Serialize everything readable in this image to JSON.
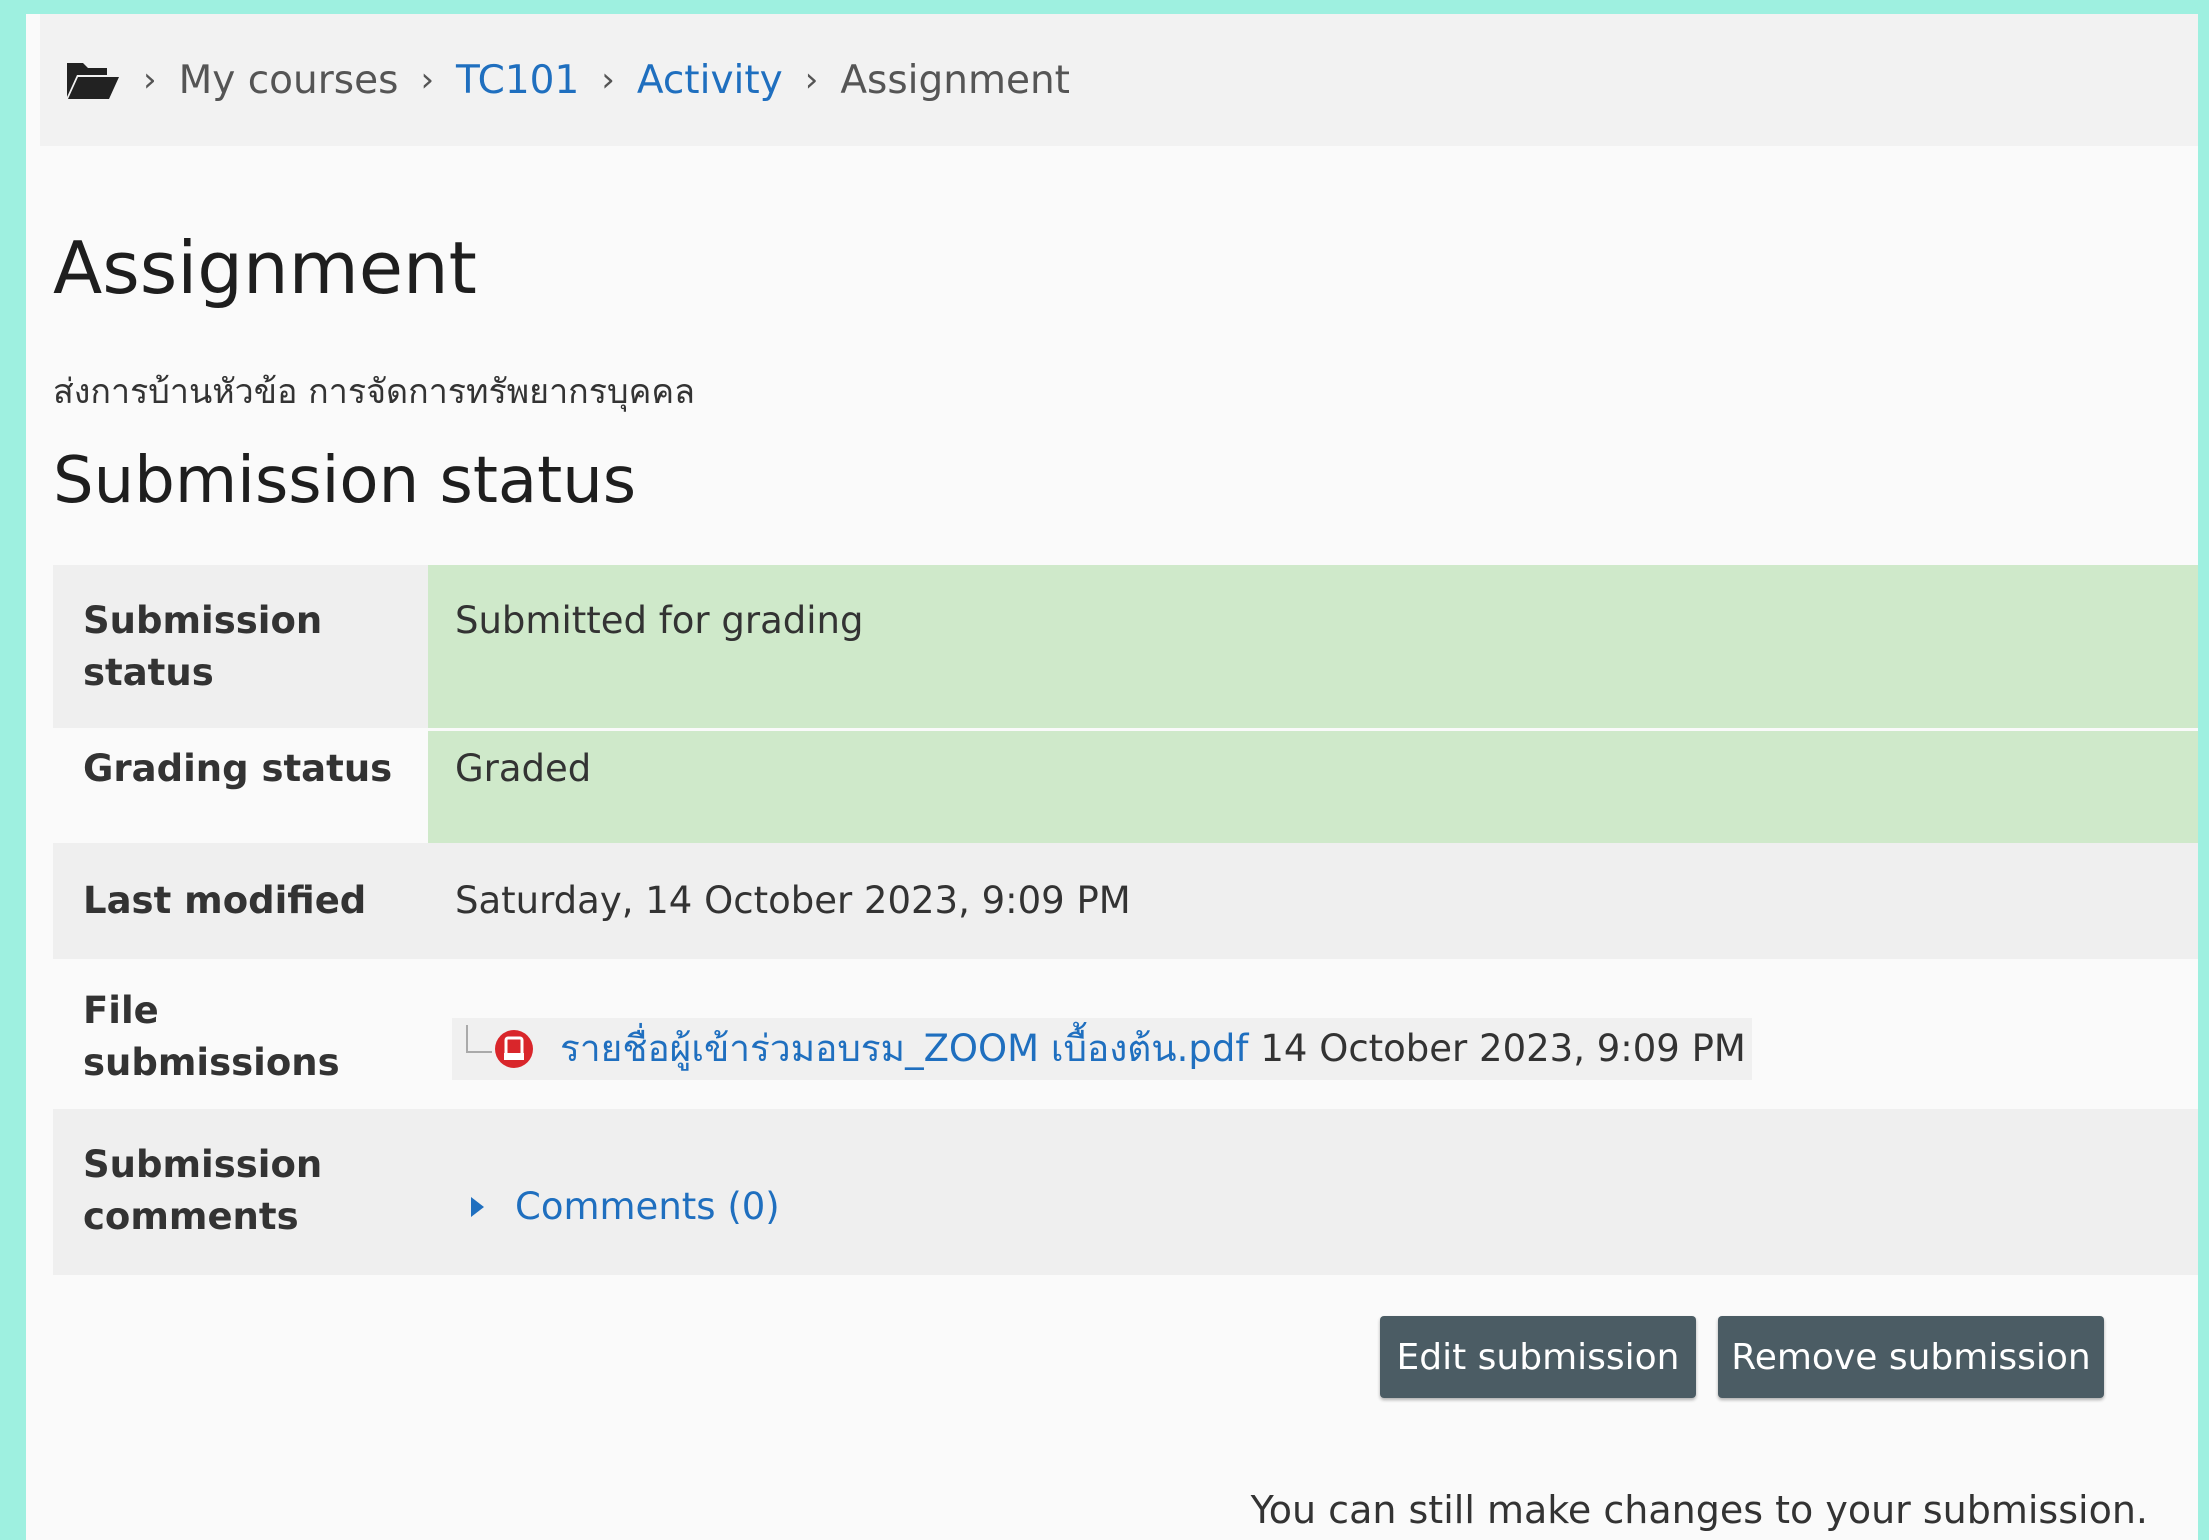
{
  "breadcrumb": {
    "items": [
      {
        "label": "My courses",
        "link": false
      },
      {
        "label": "TC101",
        "link": true
      },
      {
        "label": "Activity",
        "link": true
      },
      {
        "label": "Assignment",
        "link": false
      }
    ],
    "separator": "›"
  },
  "page": {
    "title": "Assignment",
    "intro": "ส่งการบ้านหัวข้อ การจัดการทรัพยากรบุคคล"
  },
  "submission": {
    "section_title": "Submission status",
    "rows": {
      "status": {
        "label": "Submission status",
        "value": "Submitted for grading"
      },
      "grading": {
        "label": "Grading status",
        "value": "Graded"
      },
      "modified": {
        "label": "Last modified",
        "value": "Saturday, 14 October 2023, 9:09 PM"
      },
      "files": {
        "label": "File submissions",
        "file_name": "รายชื่อผู้เข้าร่วมอบรม_ZOOM เบื้องต้น.pdf",
        "file_date": "14 October 2023, 9:09 PM",
        "file_icon": "pdf-icon"
      },
      "comments": {
        "label": "Submission comments",
        "value": "Comments (0)"
      }
    }
  },
  "actions": {
    "edit_label": "Edit submission",
    "remove_label": "Remove submission"
  },
  "note": "You can still make changes to your submission.",
  "colors": {
    "link": "#1f6fbf",
    "status_green": "#cfe9ca",
    "button": "#4b5c64",
    "frame": "#9ef0e0"
  }
}
